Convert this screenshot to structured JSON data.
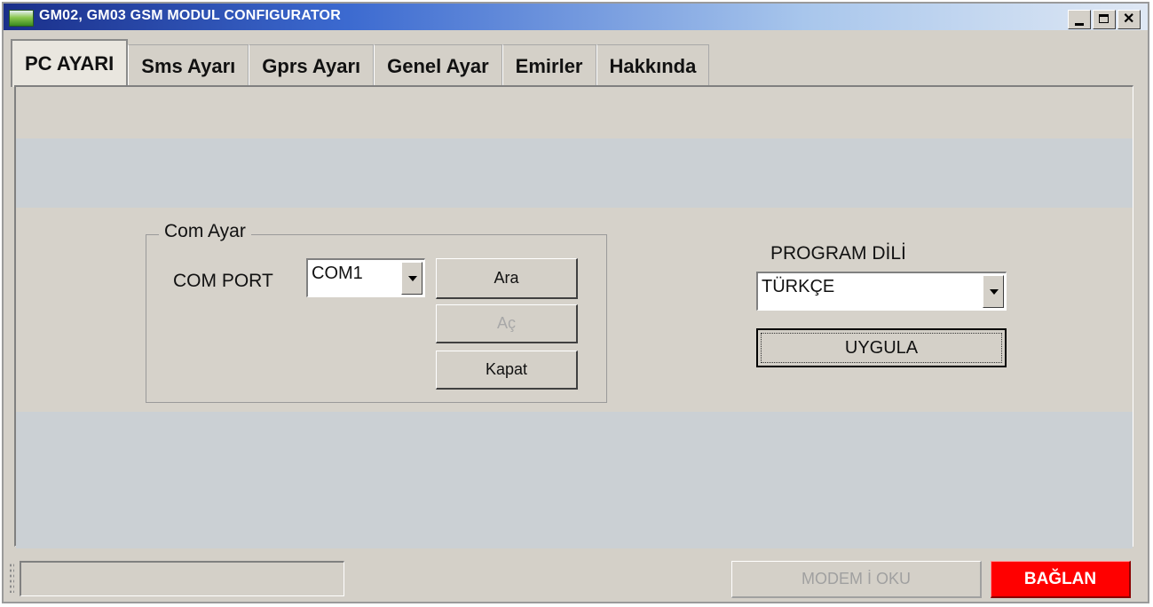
{
  "window": {
    "title": "GM02, GM03 GSM MODUL CONFIGURATOR"
  },
  "tabs": [
    {
      "label": "PC AYARI",
      "active": true
    },
    {
      "label": "Sms Ayarı",
      "active": false
    },
    {
      "label": "Gprs Ayarı",
      "active": false
    },
    {
      "label": "Genel Ayar",
      "active": false
    },
    {
      "label": "Emirler",
      "active": false
    },
    {
      "label": "Hakkında",
      "active": false
    }
  ],
  "com_group": {
    "title": "Com Ayar",
    "port_label": "COM PORT",
    "port_value": "COM1",
    "search_label": "Ara",
    "open_label": "Aç",
    "close_label": "Kapat"
  },
  "language": {
    "label": "PROGRAM DİLİ",
    "value": "TÜRKÇE",
    "apply_label": "UYGULA"
  },
  "status": {
    "text": "",
    "read_modem_label": "MODEM İ OKU",
    "connect_label": "BAĞLAN"
  },
  "colors": {
    "connect_button": "#ff0000",
    "title_bar_start": "#1a2f8a"
  }
}
